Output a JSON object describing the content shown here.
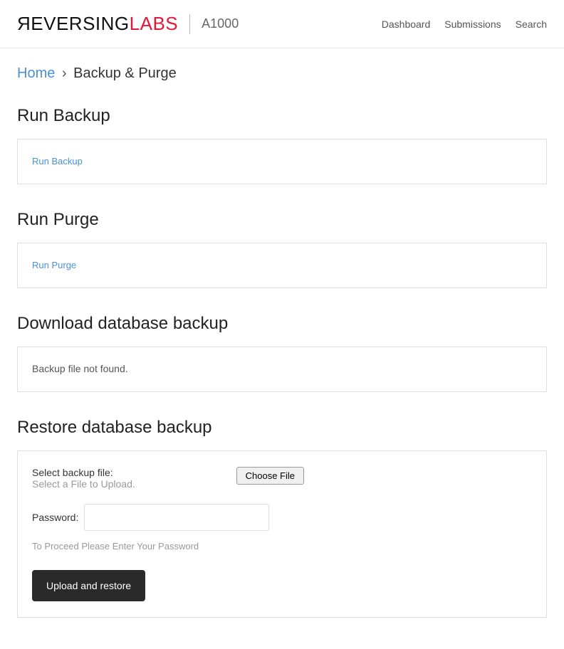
{
  "header": {
    "logo_reversing": "ЯEVERSING",
    "logo_labs": "LABS",
    "product": "A1000",
    "nav": {
      "dashboard": "Dashboard",
      "submissions": "Submissions",
      "search": "Search"
    }
  },
  "breadcrumb": {
    "home": "Home",
    "sep": "›",
    "current": "Backup & Purge"
  },
  "sections": {
    "run_backup": {
      "title": "Run Backup",
      "action": "Run Backup"
    },
    "run_purge": {
      "title": "Run Purge",
      "action": "Run Purge"
    },
    "download": {
      "title": "Download database backup",
      "message": "Backup file not found."
    },
    "restore": {
      "title": "Restore database backup",
      "select_label": "Select backup file:",
      "select_hint": "Select a File to Upload.",
      "choose_file": "Choose File",
      "password_label": "Password:",
      "password_value": "",
      "helper": "To Proceed Please Enter Your Password",
      "upload_button": "Upload and restore"
    }
  }
}
